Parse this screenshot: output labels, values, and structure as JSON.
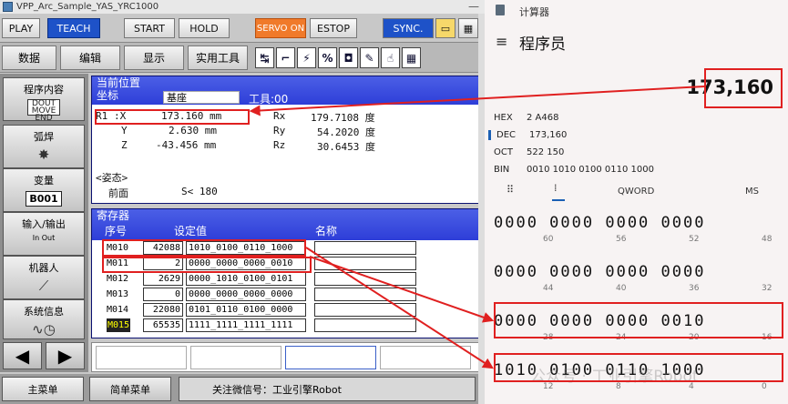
{
  "pendant": {
    "title": "VPP_Arc_Sample_YAS_YRC1000",
    "top_buttons": {
      "play": "PLAY",
      "teach": "TEACH",
      "start": "START",
      "hold": "HOLD",
      "servo_on": "SERVO ON",
      "estop": "ESTOP",
      "sync": "SYNC."
    },
    "menu_tabs": {
      "data": "数据",
      "edit": "编辑",
      "display": "显示",
      "utility": "实用工具"
    },
    "sidebar": {
      "program": "程序内容",
      "program_sub": "DOUT MOVE END",
      "arc": "弧焊",
      "variable": "变量",
      "variable_value": "B001",
      "io": "输入/输出",
      "io_sub": "In    Out",
      "robot": "机器人",
      "sysinfo": "系统信息"
    },
    "position": {
      "title": "当前位置",
      "coord_label": "坐标",
      "coord_value": "基座",
      "tool_label": "工具:00",
      "robot": "R1",
      "rows": [
        {
          "axis": ":X",
          "val": "173.160 mm",
          "raxis": "Rx",
          "rval": "179.7108 度"
        },
        {
          "axis": "Y",
          "val": "2.630 mm",
          "raxis": "Ry",
          "rval": "54.2020 度"
        },
        {
          "axis": "Z",
          "val": "-43.456 mm",
          "raxis": "Rz",
          "rval": "30.6453 度"
        }
      ],
      "pose_label": "<姿态>",
      "pose_front": "前面",
      "pose_s": "S< 180"
    },
    "register": {
      "title": "寄存器",
      "col_no": "序号",
      "col_set": "设定值",
      "col_name": "名称",
      "rows": [
        {
          "id": "M010",
          "dec": "42088",
          "bin": "1010_0100_0110_1000"
        },
        {
          "id": "M011",
          "dec": "2",
          "bin": "0000_0000_0000_0010"
        },
        {
          "id": "M012",
          "dec": "2629",
          "bin": "0000_1010_0100_0101"
        },
        {
          "id": "M013",
          "dec": "0",
          "bin": "0000_0000_0000_0000"
        },
        {
          "id": "M014",
          "dec": "22080",
          "bin": "0101_0110_0100_0000"
        },
        {
          "id": "M015",
          "dec": "65535",
          "bin": "1111_1111_1111_1111"
        }
      ]
    },
    "bottom": {
      "main_menu": "主菜单",
      "simple_menu": "简单菜单",
      "status": "关注微信号：工业引擎Robot"
    }
  },
  "calculator": {
    "title": "计算器",
    "mode": "程序员",
    "display": "173,160",
    "radix": [
      {
        "label": "HEX",
        "value": "2 A468"
      },
      {
        "label": "DEC",
        "value": "173,160"
      },
      {
        "label": "OCT",
        "value": "522 150"
      },
      {
        "label": "BIN",
        "value": "0010 1010 0100 0110 1000"
      }
    ],
    "word_size": "QWORD",
    "ms": "MS",
    "bit_rows": [
      {
        "bits": "0000 0000 0000 0000",
        "labels": [
          "60",
          "56",
          "52",
          "48"
        ]
      },
      {
        "bits": "0000 0000 0000 0000",
        "labels": [
          "44",
          "40",
          "36",
          "32"
        ]
      },
      {
        "bits": "0000 0000 0000 0010",
        "labels": [
          "28",
          "24",
          "20",
          "16"
        ]
      },
      {
        "bits": "1010 0100 0110 1000",
        "labels": [
          "12",
          "8",
          "4",
          "0"
        ]
      }
    ],
    "watermark": "公众号 · 工业引擎Robot"
  },
  "colors": {
    "panel_blue": "#1a28c8",
    "highlight_red": "#e02020",
    "teach_blue": "#1e52c8",
    "servo_orange": "#f07a2a"
  }
}
